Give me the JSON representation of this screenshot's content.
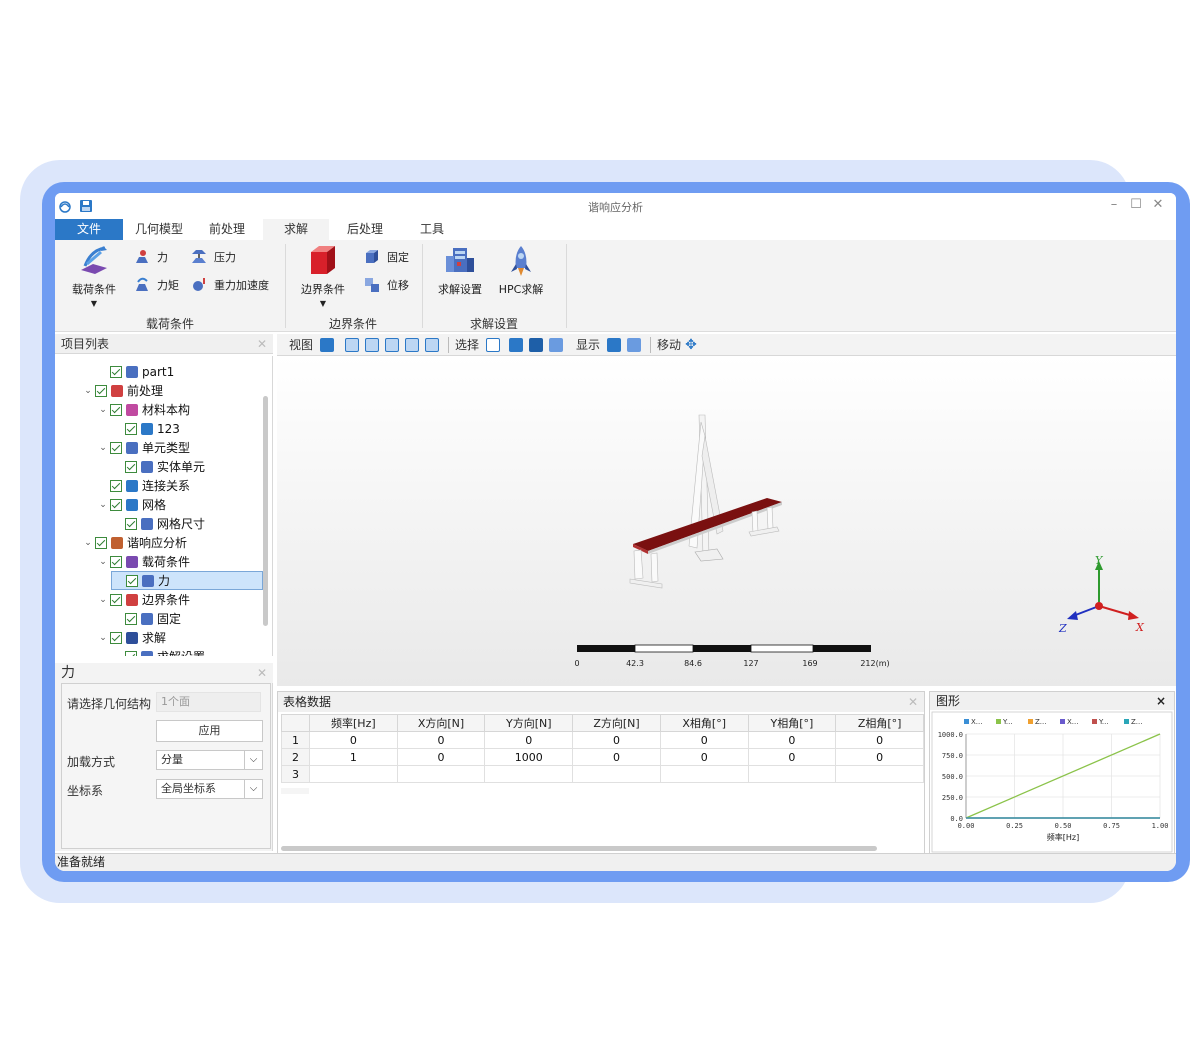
{
  "window": {
    "title": "谐响应分析"
  },
  "menu": {
    "tabs": [
      "文件",
      "几何模型",
      "前处理",
      "求解",
      "后处理",
      "工具"
    ],
    "active": "求解"
  },
  "ribbon": {
    "load_group": {
      "label": "载荷条件",
      "big_button": "载荷条件",
      "force": "力",
      "pressure": "压力",
      "moment": "力矩",
      "gravity": "重力加速度"
    },
    "boundary_group": {
      "label": "边界条件",
      "big_button": "边界条件",
      "fixed": "固定",
      "displacement": "位移"
    },
    "solve_group": {
      "label": "求解设置",
      "solve_settings": "求解设置",
      "hpc": "HPC求解"
    }
  },
  "project_list": {
    "title": "项目列表",
    "items": [
      {
        "label": "part1",
        "level": 3,
        "expander": ""
      },
      {
        "label": "前处理",
        "level": 2,
        "expander": "⌄"
      },
      {
        "label": "材料本构",
        "level": 3,
        "expander": "⌄"
      },
      {
        "label": "123",
        "level": 4,
        "expander": ""
      },
      {
        "label": "单元类型",
        "level": 3,
        "expander": "⌄"
      },
      {
        "label": "实体单元",
        "level": 4,
        "expander": ""
      },
      {
        "label": "连接关系",
        "level": 3,
        "expander": ""
      },
      {
        "label": "网格",
        "level": 3,
        "expander": "⌄"
      },
      {
        "label": "网格尺寸",
        "level": 4,
        "expander": ""
      },
      {
        "label": "谐响应分析",
        "level": 2,
        "expander": "⌄"
      },
      {
        "label": "载荷条件",
        "level": 3,
        "expander": "⌄"
      },
      {
        "label": "力",
        "level": 4,
        "expander": "",
        "selected": true
      },
      {
        "label": "边界条件",
        "level": 3,
        "expander": "⌄"
      },
      {
        "label": "固定",
        "level": 4,
        "expander": ""
      },
      {
        "label": "求解",
        "level": 3,
        "expander": "⌄"
      },
      {
        "label": "求解设置",
        "level": 4,
        "expander": ""
      }
    ]
  },
  "properties": {
    "title": "力",
    "geometry_label": "请选择几何结构",
    "geometry_value": "1个面",
    "apply_button": "应用",
    "load_method_label": "加载方式",
    "load_method_value": "分量",
    "coord_label": "坐标系",
    "coord_value": "全局坐标系"
  },
  "view_toolbar": {
    "view": "视图",
    "select": "选择",
    "display": "显示",
    "move": "移动"
  },
  "viewport": {
    "scale_labels": [
      "0",
      "42.3",
      "84.6",
      "127",
      "169",
      "212(m)"
    ],
    "axes": {
      "x": "X",
      "y": "Y",
      "z": "Z"
    }
  },
  "table": {
    "title": "表格数据",
    "headers": [
      "频率[Hz]",
      "X方向[N]",
      "Y方向[N]",
      "Z方向[N]",
      "X相角[°]",
      "Y相角[°]",
      "Z相角[°]"
    ],
    "rows": [
      {
        "n": "1",
        "cells": [
          "0",
          "0",
          "0",
          "0",
          "0",
          "0",
          "0"
        ]
      },
      {
        "n": "2",
        "cells": [
          "1",
          "0",
          "1000",
          "0",
          "0",
          "0",
          "0"
        ]
      },
      {
        "n": "3",
        "cells": [
          "",
          "",
          "",
          "",
          "",
          "",
          ""
        ]
      }
    ]
  },
  "chart_panel": {
    "title": "图形"
  },
  "chart_data": {
    "type": "line",
    "xlabel": "频率[Hz]",
    "ylabel": "",
    "xlim": [
      0,
      1
    ],
    "ylim": [
      0,
      1000
    ],
    "x_ticks": [
      "0.00",
      "0.25",
      "0.50",
      "0.75",
      "1.00"
    ],
    "y_ticks": [
      "0.0",
      "250.0",
      "500.0",
      "750.0",
      "1000.0"
    ],
    "x": [
      0,
      1
    ],
    "series": [
      {
        "name": "X...",
        "color": "#3a8fd6",
        "values": [
          0,
          0
        ]
      },
      {
        "name": "Y...",
        "color": "#8bc34a",
        "values": [
          0,
          1000
        ]
      },
      {
        "name": "Z...",
        "color": "#f0a030",
        "values": [
          0,
          0
        ]
      },
      {
        "name": "X...",
        "color": "#6a5acd",
        "values": [
          0,
          0
        ]
      },
      {
        "name": "Y...",
        "color": "#c0504d",
        "values": [
          0,
          0
        ]
      },
      {
        "name": "Z...",
        "color": "#2aa6b8",
        "values": [
          0,
          0
        ]
      }
    ]
  },
  "status": {
    "text": "准备就绪"
  }
}
